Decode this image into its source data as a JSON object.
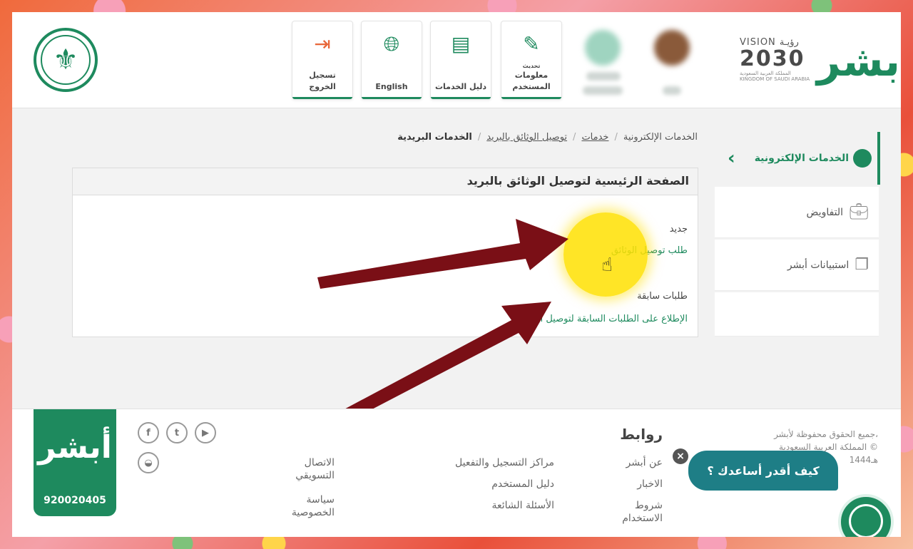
{
  "header": {
    "emblem_glyph": "⚜",
    "buttons": [
      {
        "label": "تسجيل الخروج",
        "icon": "logout-icon"
      },
      {
        "label": "English",
        "icon": "globe-icon"
      },
      {
        "label": "دليل الخدمات",
        "icon": "book-icon"
      },
      {
        "label_top": "تحديث",
        "label_mid": "معلومات",
        "label_bottom": "المستخدم",
        "icon": "edit-icon"
      }
    ],
    "vision_top": "VISION رؤيـة",
    "vision_year": "2030",
    "vision_caption": "المملكة العربية السعودية KINGDOM OF SAUDI ARABIA",
    "absher_logo": "أبشر"
  },
  "sidebar": {
    "active": {
      "label": "الخدمات الإلكترونية",
      "icon": "e-services-icon"
    },
    "items": [
      {
        "label": "التفاويض",
        "icon": "briefcase-icon"
      },
      {
        "label": "استبيانات أبشر",
        "icon": "documents-icon"
      }
    ]
  },
  "breadcrumb": [
    "الخدمات الإلكترونية",
    "خدمات",
    "توصيل الوثائق بالبريد",
    "الخدمات البريدية"
  ],
  "main": {
    "title": "الصفحة الرئيسية لتوصيل الوثائق بالبريد",
    "new_heading": "جديد",
    "new_link": "طلب توصيل الوثائق",
    "previous_heading": "طلبات سابقة",
    "previous_link": "الإطلاع على الطلبات السابقة لتوصيل الوثائق"
  },
  "footer": {
    "logo_glyph": "أبشر",
    "phone": "920020405",
    "links_title": "روابط",
    "col1": [
      "عن أبشر",
      "الاخبار",
      "شروط الاستخدام"
    ],
    "col2": [
      "مراكز التسجيل والتفعيل",
      "دليل المستخدم",
      "الأسئلة الشائعة"
    ],
    "col3": [
      "الاتصال التسويقي",
      "سياسة الخصوصية"
    ],
    "copyright": [
      "جميع الحقوق محفوظة لأبشر،",
      "المملكة العربية السعودية ©",
      "1444هـ"
    ]
  },
  "chat": {
    "help_text": "كيف أقدر أساعدك ؟"
  },
  "colors": {
    "brand_green": "#1e8a5e",
    "chat_teal": "#1e7e86",
    "highlight_yellow": "#ffe000",
    "arrow_red": "#7a0f16",
    "logout_orange": "#e8673a"
  }
}
